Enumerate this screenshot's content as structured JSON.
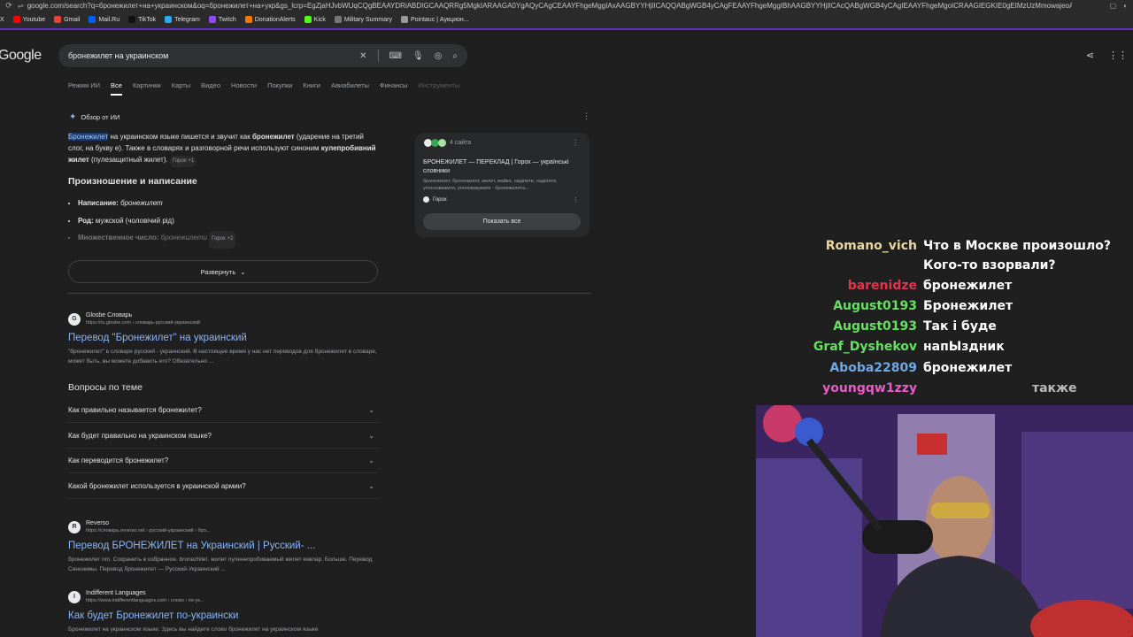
{
  "browser": {
    "url": "google.com/search?q=бронежилет+на+украинском&oq=бронежилет+на+укр&gs_lcrp=EgZjaHJvbWUqCQgBEAAYDRiABDIGCAAQRRg5MgkIARAAGA0YgAQyCAgCEAAYFhgeMggIAxAAGBYYHjIICAQQABgWGB4yCAgFEAAYFhgeMggIBhAAGBYYHjIICAcQABgWGB4yCAgIEAAYFhgeMgoICRAAGIEGKIE0gEIMzUzMmowajeoAgCwAgA&sourceid=chrome..."
  },
  "bookmarks": [
    {
      "label": "X",
      "color": "#000000"
    },
    {
      "label": "Youtube",
      "color": "#ff0000"
    },
    {
      "label": "Gmail",
      "color": "#ea4335"
    },
    {
      "label": "Mail.Ru",
      "color": "#005ff9"
    },
    {
      "label": "TikTok",
      "color": "#111111"
    },
    {
      "label": "Telegram",
      "color": "#2aabee"
    },
    {
      "label": "Twitch",
      "color": "#9146ff"
    },
    {
      "label": "DonationAlerts",
      "color": "#f57507"
    },
    {
      "label": "Kick",
      "color": "#53fc18"
    },
    {
      "label": "Military Summary",
      "color": "#777777"
    },
    {
      "label": "Pointauc | Аукцион...",
      "color": "#999999"
    }
  ],
  "google": {
    "logo": "Google",
    "query": "бронежилет на украинском",
    "tabs": [
      "Режим ИИ",
      "Все",
      "Картинки",
      "Карты",
      "Видео",
      "Новости",
      "Покупки",
      "Книги",
      "Авиабилеты",
      "Финансы",
      "Инструменты"
    ]
  },
  "ai": {
    "title": "Обзор от ИИ",
    "p1_hl": "Бронежилет",
    "p1_a": " на украинском языке пишется и звучит как ",
    "p1_b": "бронежилет",
    "p1_c": " (ударение на третий слог, на букву е). Также в словарях и разговорной речи используют синоним ",
    "p1_d": "кулепробивний жилет",
    "p1_e": " (пулезащитный жилет). ",
    "p1_chip": "Горох +1",
    "heading": "Произношение и написание",
    "li1_label": "Написание:",
    "li1_value": " бронежилет",
    "li2_label": "Род:",
    "li2_value": " мужской (чоловічий рід)",
    "li3_label": "Множественное число:",
    "li3_value": " бронежилети",
    "li3_chip": "Горох +2",
    "expand": "Развернуть",
    "sources_count": "4 сайта",
    "source_title": "БРОНЕЖИЛЕТ — ПЕРЕКЛАД | Горох — українські словники",
    "source_snip": "бронежилет, бронежилет, жилет, майка, надіпити, надіпяти, упосноважити, упоновакувати · бронежилета...",
    "source_name": "Горох",
    "show_all": "Показать все"
  },
  "results": {
    "r1": {
      "name": "Glosbe Словарь",
      "url": "https://ru.glosbe.com › словарь-русский-украинский",
      "title": "Перевод \"Бронежилет\" на украинский",
      "snippet": "\"бронежилет\" в словаре русский - украинский. В настоящее время у нас нет переводов для бронежилет в словаре, может быть, вы можете добавить его? Обязательно ..."
    },
    "paa_title": "Вопросы по теме",
    "paa": [
      "Как правильно называется бронежилет?",
      "Как будет правильно на украинском языке?",
      "Как переводится бронежилет?",
      "Какой бронежилет используется в украинской армии?"
    ],
    "r2": {
      "name": "Reverso",
      "url": "https://словарь.reverso.net › русский-украинский › бро...",
      "title": "Перевод БРОНЕЖИЛЕТ на Украинский | Русский- ...",
      "snippet": "бронежилет nm. Сохранить в избранное. bronezhilet. жилет пуленепробиваемый жилет кевлар. Больше. Перевод Синонимы. Перевод бронежилет — Русский-Украинский ..."
    },
    "r3": {
      "name": "Indifferent Languages",
      "url": "https://www.indifferentlanguages.com › слово › по-ук...",
      "title": "Как будет Бронежилет по-украински",
      "snippet": "Бронежилет на украинском языке: Здесь вы найдете слово бронежилет на украинском языке"
    }
  },
  "chat": [
    {
      "user": "Romano_vich",
      "color": "#e8d7a0",
      "text": "Что в Москве произошло?"
    },
    {
      "user": "",
      "color": "#ffffff",
      "text": "Кого-то взорвали?"
    },
    {
      "user": "barenidze",
      "color": "#e0344c",
      "text": "бронежилет"
    },
    {
      "user": "August0193",
      "color": "#66e060",
      "text": "Бронежилет"
    },
    {
      "user": "August0193",
      "color": "#66e060",
      "text": "Так і буде"
    },
    {
      "user": "Graf_Dyshekov",
      "color": "#66e060",
      "text": "напЫздник"
    },
    {
      "user": "Aboba22809",
      "color": "#6ea8e8",
      "text": "бронежилет"
    },
    {
      "user": "youngqw1zzy",
      "color": "#e85cc8",
      "text": "также"
    }
  ]
}
